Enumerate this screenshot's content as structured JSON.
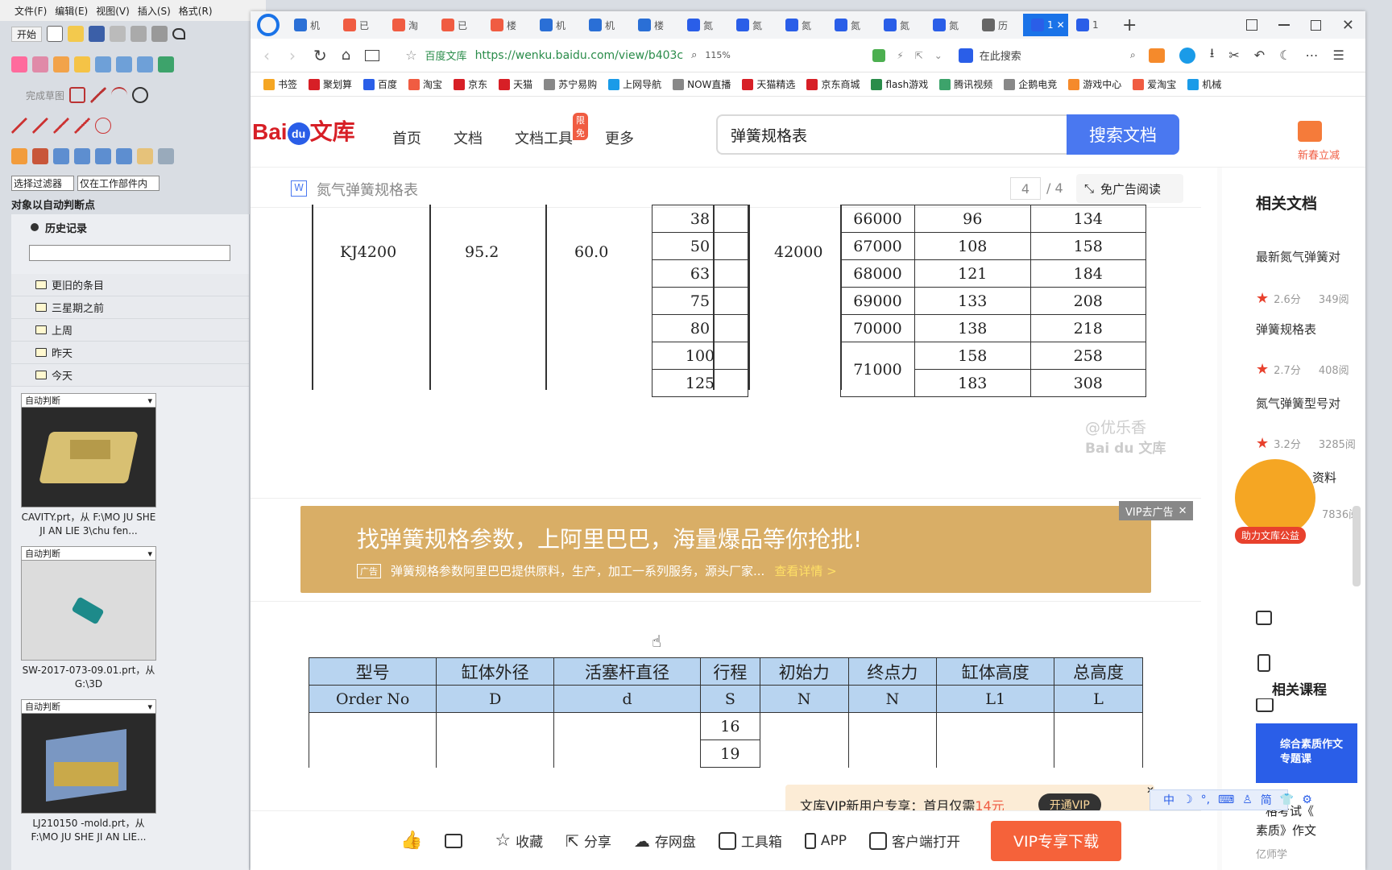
{
  "cad": {
    "menu": [
      "文件(F)",
      "编辑(E)",
      "视图(V)",
      "插入(S)",
      "格式(R)"
    ],
    "start_label": "开始",
    "finish_sketch": "完成草图",
    "filter_label": "选择过滤器",
    "filter_scope": "仅在工作部件内",
    "auto_break": "对象以自动判断点",
    "history_title": "历史记录",
    "history_folders": [
      "更旧的条目",
      "三星期之前",
      "上周",
      "昨天",
      "今天"
    ],
    "thumbs": [
      {
        "mode": "自动判断",
        "caption": "CAVITY.prt，从 F:\\MO JU SHE JI AN LIE 3\\chu fen..."
      },
      {
        "mode": "自动判断",
        "caption": "SW-2017-073-09.01.prt，从 G:\\3D"
      },
      {
        "mode": "自动判断",
        "caption": "LJ210150 -mold.prt，从 F:\\MO JU SHE JI AN LIE..."
      }
    ]
  },
  "browser": {
    "tabs": [
      "机",
      "已",
      "淘",
      "已",
      "楼",
      "机",
      "机",
      "楼",
      "氮",
      "氮",
      "氮",
      "氮",
      "氮",
      "氮",
      "历",
      "1",
      "1"
    ],
    "active_tab_index": 15,
    "site_name": "百度文库",
    "url": "https://wenku.baidu.com/view/b403c",
    "zoom": "115%",
    "search_placeholder": "在此搜索",
    "bookmarks": [
      "书签",
      "聚划算",
      "百度",
      "淘宝",
      "京东",
      "天猫",
      "苏宁易购",
      "上网导航",
      "NOW直播",
      "天猫精选",
      "京东商城",
      "flash游戏",
      "腾讯视频",
      "企鹅电竞",
      "游戏中心",
      "爱淘宝",
      "机械"
    ]
  },
  "wenku": {
    "logo": "Bai du 文库",
    "nav": [
      "首页",
      "文档",
      "文档工具",
      "更多"
    ],
    "nav_badge": "限免",
    "search_value": "弹簧规格表",
    "search_button": "搜索文档",
    "vip_promo": "新春立减",
    "doc_title": "氮气弹簧规格表",
    "page_current": "4",
    "page_total": "/ 4",
    "ad_free": "免广告阅读",
    "watermark_1": "@优乐香",
    "watermark_2": "Bai du 文库",
    "ad": {
      "headline": "找弹簧规格参数，上阿里巴巴，海量爆品等你抢批!",
      "tag": "广告",
      "sub": "弹簧规格参数阿里巴巴提供原料，生产，加工一系列服务，源头厂家...",
      "link": "查看详情 >",
      "vip_remove": "VIP去广告"
    },
    "table_top": {
      "model": "KJ4200",
      "d1": "95.2",
      "d2": "60.0",
      "force": "42000",
      "rows": [
        {
          "s": "38",
          "n": "66000",
          "l1": "96",
          "l": "134"
        },
        {
          "s": "50",
          "n": "67000",
          "l1": "108",
          "l": "158"
        },
        {
          "s": "63",
          "n": "68000",
          "l1": "121",
          "l": "184"
        },
        {
          "s": "75",
          "n": "69000",
          "l1": "133",
          "l": "208"
        },
        {
          "s": "80",
          "n": "70000",
          "l1": "138",
          "l": "218"
        },
        {
          "s": "100",
          "n": "71000",
          "l1": "158",
          "l": "258"
        },
        {
          "s": "125",
          "n": "",
          "l1": "183",
          "l": "308"
        }
      ]
    },
    "table_bottom": {
      "headers_cn": [
        "型号",
        "缸体外径",
        "活塞杆直径",
        "行程",
        "初始力",
        "终点力",
        "缸体高度",
        "总高度"
      ],
      "headers_en": [
        "Order No",
        "D",
        "d",
        "S",
        "N",
        "N",
        "L1",
        "L"
      ],
      "strokes": [
        "16",
        "19"
      ]
    },
    "sidebar": {
      "title": "相关文档",
      "items": [
        {
          "title": "最新氮气弹簧对",
          "score": "2.6分",
          "views": "349阅"
        },
        {
          "title": "弹簧规格表",
          "score": "2.7分",
          "views": "408阅"
        },
        {
          "title": "氮气弹簧型号对",
          "score": "3.2分",
          "views": "3285阅"
        }
      ],
      "partial_item": "资料",
      "partial_views": "7836阅",
      "mascot_label": "助力文库公益",
      "courses_title": "相关课程",
      "course_banner": "综合素质作文专题课",
      "bottom_item_1": "格考试《",
      "bottom_item_2": "素质》作文",
      "bottom_item_3": "亿师学"
    },
    "vip_toast": {
      "text_prefix": "文库VIP新用户专享：首月仅需",
      "price": "14元",
      "button": "开通VIP"
    },
    "ime_bar": [
      "中",
      "简"
    ],
    "bottom_bar": [
      "收藏",
      "分享",
      "存网盘",
      "工具箱",
      "APP",
      "客户端打开"
    ],
    "download_button": "VIP专享下载"
  }
}
